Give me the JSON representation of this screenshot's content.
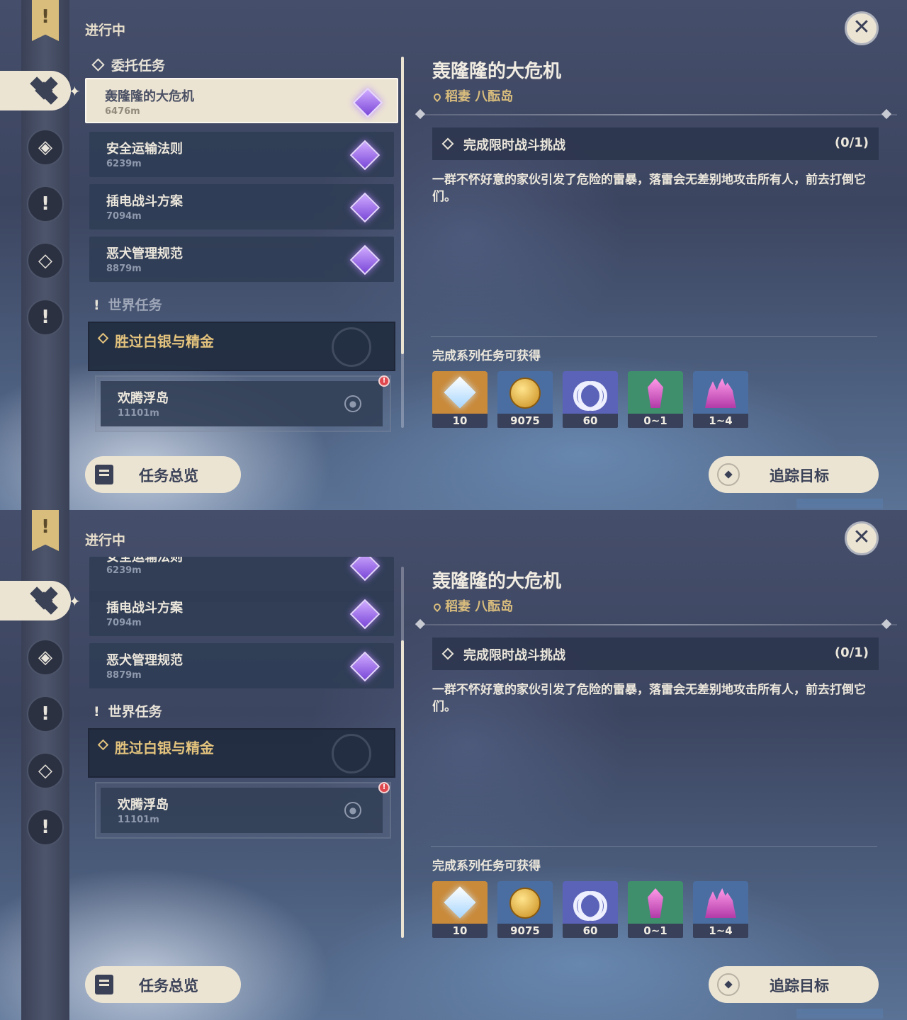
{
  "status_label": "进行中",
  "close_icon": "close-icon",
  "rail": {
    "flag_glyph": "!",
    "icons": [
      "commission-icon",
      "archon-icon",
      "world-quest-icon",
      "event-icon",
      "alert-icon"
    ]
  },
  "groups": {
    "commission": "委托任务",
    "world": "世界任务",
    "world_bang": "!"
  },
  "quests": [
    {
      "name": "轰隆隆的大危机",
      "distance": "6476m"
    },
    {
      "name": "安全运输法则",
      "distance": "6239m"
    },
    {
      "name": "插电战斗方案",
      "distance": "7094m"
    },
    {
      "name": "恶犬管理规范",
      "distance": "8879m"
    }
  ],
  "world_quest": {
    "name": "胜过白银与精金",
    "sub": {
      "name": "欢腾浮岛",
      "distance": "11101m",
      "alert": "!"
    }
  },
  "detail": {
    "title": "轰隆隆的大危机",
    "location": "稻妻 八酝岛",
    "objective": "完成限时战斗挑战",
    "progress": "(0/1)",
    "description": "一群不怀好意的家伙引发了危险的雷暴，落雷会无差别地攻击所有人，前去打倒它们。",
    "rewards_label": "完成系列任务可获得",
    "rewards": [
      {
        "icon": "primogem-icon",
        "count": "10",
        "color": "#c98a3a"
      },
      {
        "icon": "mora-icon",
        "count": "9075",
        "color": "#4a6ea2"
      },
      {
        "icon": "fellowship-icon",
        "count": "60",
        "color": "#5b63b8"
      },
      {
        "icon": "crystal-chunk-icon",
        "count": "0~1",
        "color": "#3f8f6d"
      },
      {
        "icon": "crystal-cluster-icon",
        "count": "1~4",
        "color": "#4a6ea2"
      }
    ]
  },
  "buttons": {
    "overview": "任务总览",
    "track": "追踪目标"
  },
  "scroll": {
    "panel_a": 0,
    "panel_b": 1
  }
}
